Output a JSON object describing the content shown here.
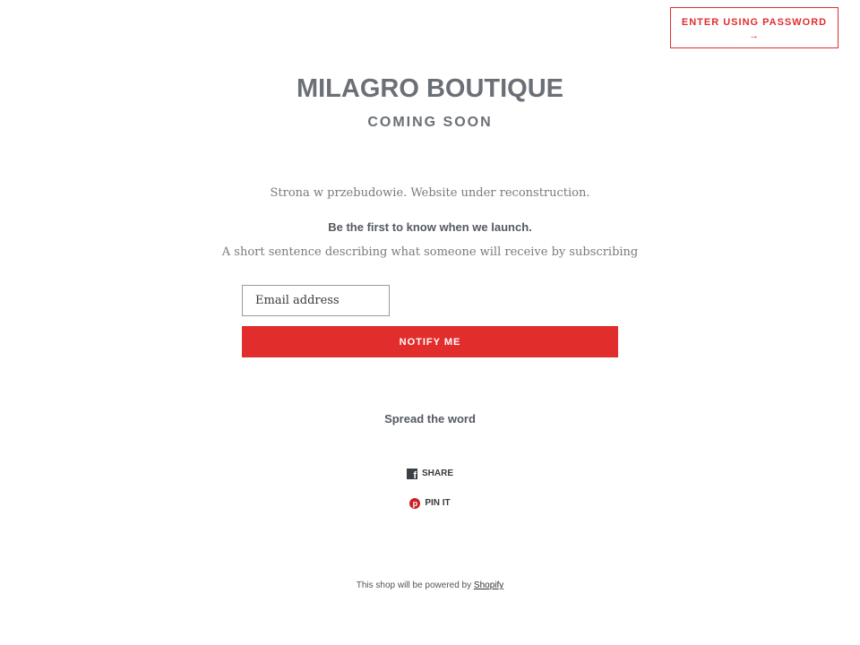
{
  "header": {
    "password_button_label": "ENTER USING PASSWORD",
    "password_button_arrow": "→"
  },
  "store": {
    "name": "MILAGRO BOUTIQUE",
    "status": "COMING SOON"
  },
  "content": {
    "message": "Strona w przebudowie. Website under reconstruction.",
    "launch_heading": "Be the first to know when we launch.",
    "description": "A short sentence describing what someone will receive by subscribing"
  },
  "form": {
    "email_placeholder": "Email address",
    "email_value": "",
    "notify_label": "NOTIFY ME"
  },
  "social": {
    "heading": "Spread the word",
    "share_label": "SHARE",
    "pin_label": "PIN IT",
    "facebook_icon": "facebook-icon",
    "pinterest_icon": "pinterest-icon"
  },
  "footer": {
    "text": "This shop will be powered by",
    "link_label": "Shopify"
  },
  "colors": {
    "accent": "#e22d2d",
    "heading": "#6b6f76",
    "body_text": "#7a7a7a"
  }
}
